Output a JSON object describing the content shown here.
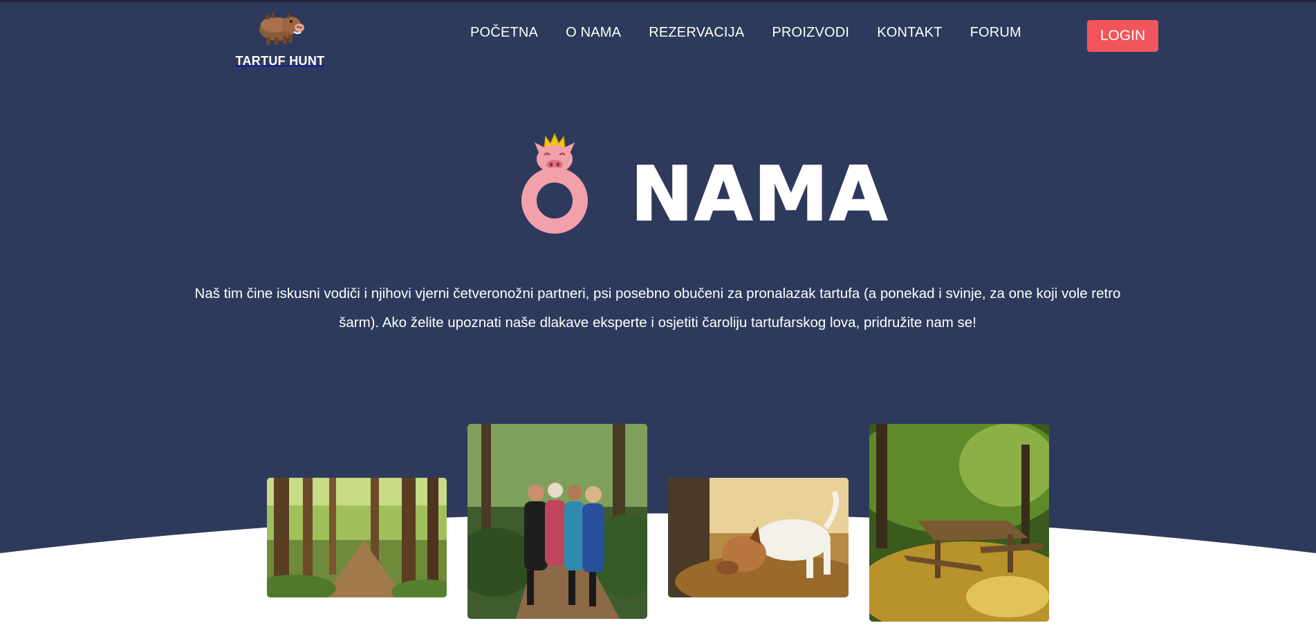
{
  "brand": {
    "name": "TARTUF HUNT",
    "logo_icon": "boar-icon"
  },
  "nav": {
    "items": [
      "POČETNA",
      "O NAMA",
      "REZERVACIJA",
      "PROIZVODI",
      "KONTAKT",
      "FORUM"
    ]
  },
  "login": {
    "label": "LOGIN"
  },
  "hero": {
    "title_rest": "NAMA",
    "title_first_letter_icon": "crowned-pig-o-icon",
    "text": "Naš tim čine iskusni vodiči i njihovi vjerni četveronožni partneri, psi posebno obučeni za pronalazak tartufa (a ponekad i svinje, za one koji vole retro šarm). Ako želite upoznati naše dlakave eksperte i osjetiti čaroliju tartufarskog lova, pridružite nam se!"
  },
  "gallery": {
    "photos": [
      "forest-trail-photo",
      "hikers-group-photo",
      "truffle-dog-photo",
      "picnic-table-photo"
    ]
  },
  "colors": {
    "background": "#2e3a5c",
    "accent": "#f2545b",
    "pig_pink": "#f2a0aa",
    "text": "#ffffff"
  }
}
